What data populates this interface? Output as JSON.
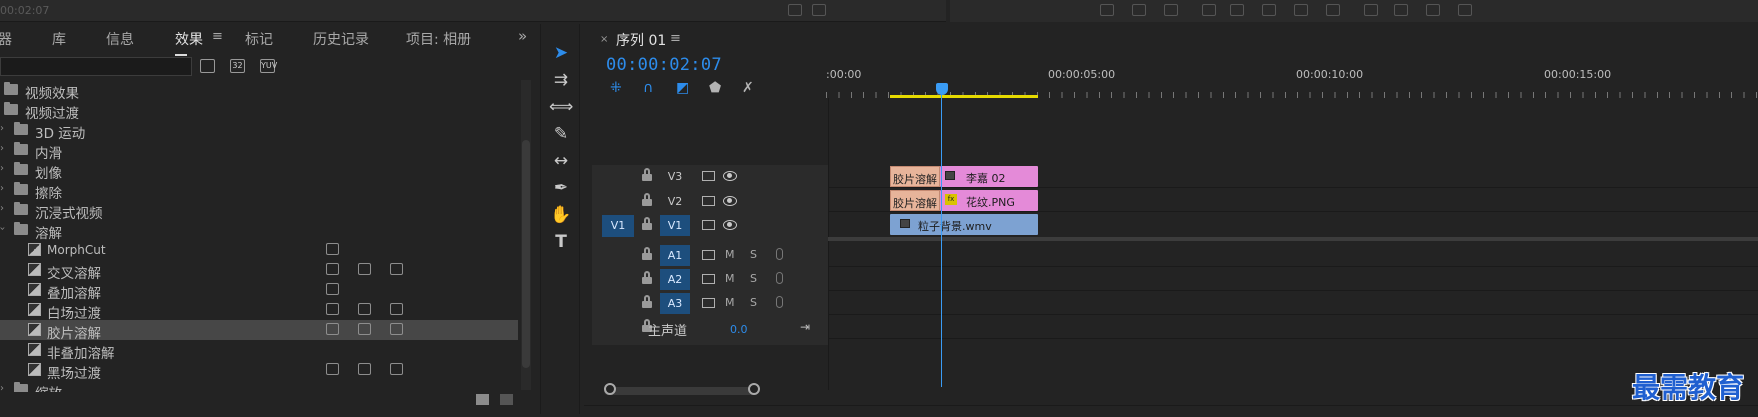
{
  "top_strip": {
    "timecode": "00:02:07"
  },
  "effects": {
    "tabs": [
      {
        "label": "器",
        "active": false
      },
      {
        "label": "库",
        "active": false
      },
      {
        "label": "信息",
        "active": false
      },
      {
        "label": "效果",
        "active": true
      },
      {
        "label": "标记",
        "active": false
      },
      {
        "label": "历史记录",
        "active": false
      },
      {
        "label": "项目: 相册",
        "active": false
      }
    ],
    "menu_glyph": "≡",
    "overflow_glyph": "»",
    "search_value": "",
    "badges": [
      "32",
      "YUV"
    ],
    "tree": [
      {
        "label": "视频效果",
        "kind": "folder",
        "level": 0,
        "expanded": false
      },
      {
        "label": "视频过渡",
        "kind": "folder",
        "level": 0,
        "expanded": true
      },
      {
        "label": "3D 运动",
        "kind": "folder",
        "level": 1,
        "expanded": false
      },
      {
        "label": "内滑",
        "kind": "folder",
        "level": 1,
        "expanded": false
      },
      {
        "label": "划像",
        "kind": "folder",
        "level": 1,
        "expanded": false
      },
      {
        "label": "擦除",
        "kind": "folder",
        "level": 1,
        "expanded": false
      },
      {
        "label": "沉浸式视频",
        "kind": "folder",
        "level": 1,
        "expanded": false
      },
      {
        "label": "溶解",
        "kind": "folder",
        "level": 1,
        "expanded": true
      },
      {
        "label": "MorphCut",
        "kind": "effect",
        "level": 2,
        "badges": 1
      },
      {
        "label": "交叉溶解",
        "kind": "effect",
        "level": 2,
        "badges": 3
      },
      {
        "label": "叠加溶解",
        "kind": "effect",
        "level": 2,
        "badges": 1
      },
      {
        "label": "白场过渡",
        "kind": "effect",
        "level": 2,
        "badges": 3
      },
      {
        "label": "胶片溶解",
        "kind": "effect",
        "level": 2,
        "badges": 3,
        "selected": true
      },
      {
        "label": "非叠加溶解",
        "kind": "effect",
        "level": 2,
        "badges": 1
      },
      {
        "label": "黑场过渡",
        "kind": "effect",
        "level": 2,
        "badges": 3
      },
      {
        "label": "缩放",
        "kind": "folder",
        "level": 1,
        "expanded": false
      }
    ]
  },
  "sequence": {
    "tab_name": "序列 01",
    "close_glyph": "×",
    "menu_glyph": "≡",
    "timecode": "00:00:02:07",
    "ruler": [
      ":00:00",
      "00:00:05:00",
      "00:00:10:00",
      "00:00:15:00"
    ],
    "tracks_video": [
      {
        "name": "V3"
      },
      {
        "name": "V2"
      },
      {
        "name": "V1",
        "source": "V1"
      }
    ],
    "tracks_audio": [
      {
        "name": "A1",
        "m": "M",
        "s": "S"
      },
      {
        "name": "A2",
        "m": "M",
        "s": "S"
      },
      {
        "name": "A3",
        "m": "M",
        "s": "S"
      }
    ],
    "master": {
      "label": "主声道",
      "value": "0.0",
      "end_glyph": "⇥"
    },
    "clips": {
      "v3": {
        "transition": "胶片溶解",
        "name": "李嘉 02",
        "color": "#e48ad8"
      },
      "v2": {
        "transition": "胶片溶解",
        "name": "花纹.PNG",
        "color": "#e48ad8",
        "fx": "fx"
      },
      "v1": {
        "name": "粒子背景.wmv",
        "color": "#7da2d2"
      }
    }
  },
  "watermark": "最需教育"
}
